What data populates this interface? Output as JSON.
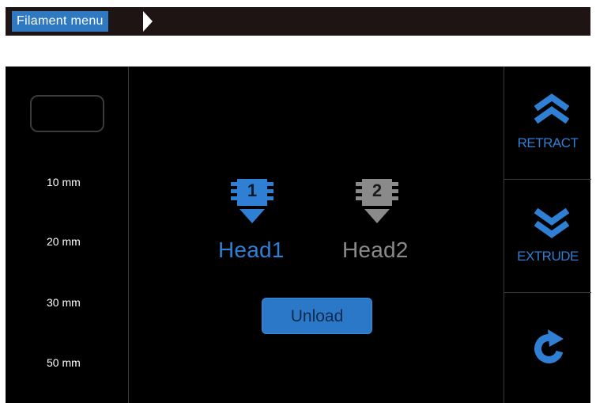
{
  "header": {
    "title": "Filament menu"
  },
  "lengths": {
    "options": [
      "10 mm",
      "20 mm",
      "30 mm",
      "50 mm"
    ],
    "selected_value": ""
  },
  "heads": [
    {
      "number": "1",
      "label": "Head1",
      "selected": true
    },
    {
      "number": "2",
      "label": "Head2",
      "selected": false
    }
  ],
  "unload_label": "Unload",
  "retract_label": "RETRACT",
  "extrude_label": "EXTRUDE",
  "icons": {
    "head_selected": "extruder-head-icon",
    "head_unselected": "extruder-head-icon",
    "retract": "double-chevron-up-icon",
    "extrude": "double-chevron-down-icon",
    "refresh": "refresh-icon"
  },
  "colors": {
    "accent_blue": "#2f78c2",
    "selected_head": "#2f7fd4",
    "unselected_head": "#8a8a8a",
    "screen_background": "#000000",
    "header_background": "#1e1414"
  }
}
